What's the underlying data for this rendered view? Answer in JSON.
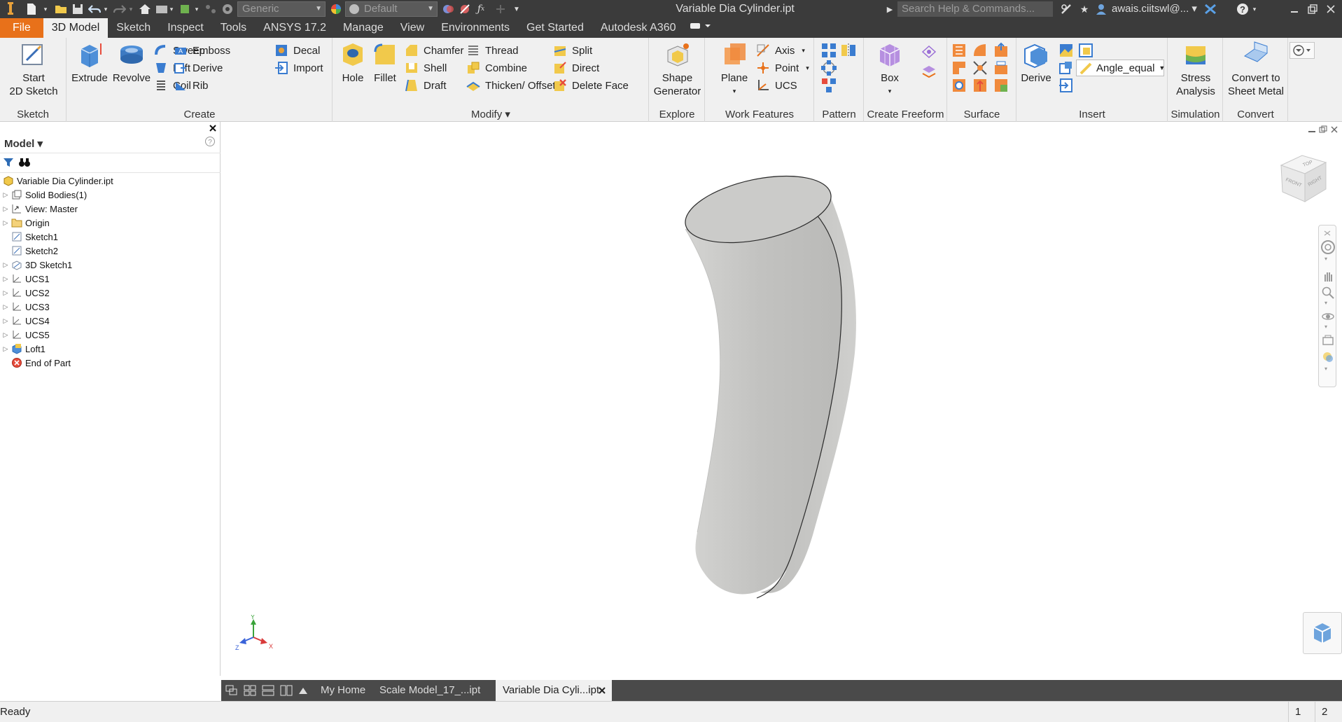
{
  "title_bar": {
    "material_combo": "Generic",
    "appearance_combo": "Default",
    "document_title": "Variable Dia Cylinder.ipt",
    "search_placeholder": "Search Help & Commands...",
    "user": "awais.ciitswl@..."
  },
  "ribbon_tabs": [
    "File",
    "3D Model",
    "Sketch",
    "Inspect",
    "Tools",
    "ANSYS 17.2",
    "Manage",
    "View",
    "Environments",
    "Get Started",
    "Autodesk A360"
  ],
  "active_tab": "3D Model",
  "ribbon": {
    "sketch": {
      "label": "Sketch",
      "start_sketch": "Start\n2D Sketch"
    },
    "create": {
      "label": "Create",
      "extrude": "Extrude",
      "revolve": "Revolve",
      "sweep": "Sweep",
      "loft": "Loft",
      "coil": "Coil",
      "emboss": "Emboss",
      "derive": "Derive",
      "rib": "Rib",
      "decal": "Decal",
      "import": "Import"
    },
    "modify": {
      "label": "Modify ▾",
      "hole": "Hole",
      "fillet": "Fillet",
      "chamfer": "Chamfer",
      "shell": "Shell",
      "draft": "Draft",
      "thread": "Thread",
      "combine": "Combine",
      "thicken": "Thicken/ Offset",
      "split": "Split",
      "direct": "Direct",
      "delete_face": "Delete Face"
    },
    "explore": {
      "label": "Explore",
      "shape_generator": "Shape\nGenerator"
    },
    "work_features": {
      "label": "Work Features",
      "plane": "Plane",
      "axis": "Axis",
      "point": "Point",
      "ucs": "UCS"
    },
    "pattern": {
      "label": "Pattern"
    },
    "freeform": {
      "label": "Create Freeform",
      "box": "Box"
    },
    "surface": {
      "label": "Surface"
    },
    "insert": {
      "label": "Insert",
      "derive": "Derive",
      "param_combo": "Angle_equal"
    },
    "simulation": {
      "label": "Simulation",
      "stress": "Stress\nAnalysis"
    },
    "convert": {
      "label": "Convert",
      "sheet_metal": "Convert to\nSheet Metal"
    }
  },
  "browser": {
    "title": "Model ▾",
    "nodes": [
      {
        "label": "Variable Dia Cylinder.ipt",
        "icon": "part-icon",
        "expander": false,
        "indent": 0
      },
      {
        "label": "Solid Bodies(1)",
        "icon": "solid-bodies-icon",
        "expander": true,
        "indent": 1
      },
      {
        "label": "View: Master",
        "icon": "view-icon",
        "expander": true,
        "indent": 1
      },
      {
        "label": "Origin",
        "icon": "folder-icon",
        "expander": true,
        "indent": 1
      },
      {
        "label": "Sketch1",
        "icon": "sketch-icon",
        "expander": false,
        "indent": 1
      },
      {
        "label": "Sketch2",
        "icon": "sketch-icon",
        "expander": false,
        "indent": 1
      },
      {
        "label": "3D Sketch1",
        "icon": "sketch-3d-icon",
        "expander": true,
        "indent": 1
      },
      {
        "label": "UCS1",
        "icon": "ucs-icon",
        "expander": true,
        "indent": 1
      },
      {
        "label": "UCS2",
        "icon": "ucs-icon",
        "expander": true,
        "indent": 1
      },
      {
        "label": "UCS3",
        "icon": "ucs-icon",
        "expander": true,
        "indent": 1
      },
      {
        "label": "UCS4",
        "icon": "ucs-icon",
        "expander": true,
        "indent": 1
      },
      {
        "label": "UCS5",
        "icon": "ucs-icon",
        "expander": true,
        "indent": 1
      },
      {
        "label": "Loft1",
        "icon": "loft-icon",
        "expander": true,
        "indent": 1
      },
      {
        "label": "End of Part",
        "icon": "end-of-part-icon",
        "expander": false,
        "indent": 1
      }
    ]
  },
  "viewcube": {
    "top": "TOP",
    "front": "FRONT",
    "right": "RIGHT"
  },
  "triad": {
    "x": "X",
    "y": "Y",
    "z": "Z"
  },
  "doc_tabs": [
    "My Home",
    "Scale Model_17_...ipt",
    "Variable Dia Cyli...ipt"
  ],
  "active_doc_tab": 2,
  "status": {
    "text": "Ready",
    "count1": "1",
    "count2": "2"
  },
  "colors": {
    "file_tab": "#e8711a",
    "title_bar": "#3b3b3b",
    "ribbon": "#f0f0f0",
    "doc_tabs_bar": "#4a4a4a",
    "part_fill": "#c9c9c7"
  }
}
